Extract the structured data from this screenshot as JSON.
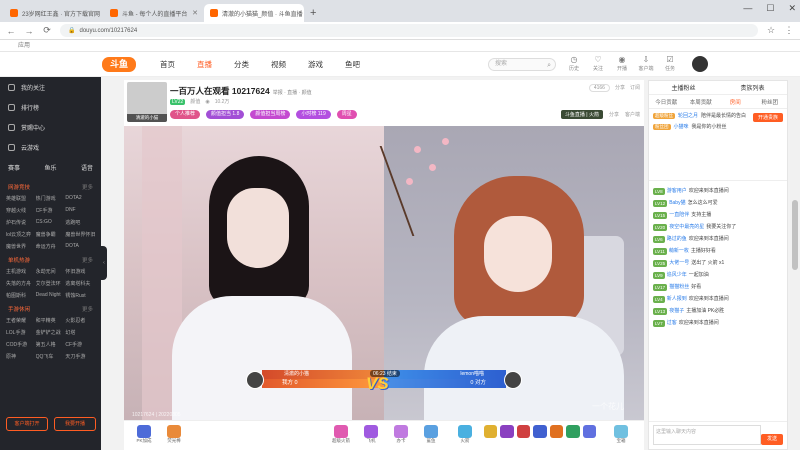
{
  "browser": {
    "tabs": [
      {
        "label": "23岁网红王鑫 · 官方下载官网"
      },
      {
        "label": "斗鱼 - 每个人的直播平台"
      },
      {
        "label": "清澈的小猫猫_颜值 · 斗鱼直播"
      }
    ],
    "url": "douyu.com/10217624",
    "bookmarks": "应用"
  },
  "site": {
    "logo": "斗鱼",
    "nav": [
      "首页",
      "直播",
      "分类",
      "视频",
      "游戏",
      "鱼吧"
    ],
    "search_placeholder": "搜索",
    "header_icons": [
      "历史",
      "关注",
      "开播",
      "客户端",
      "任务"
    ]
  },
  "sidebar": {
    "items": [
      "我的关注",
      "排行榜",
      "赏赐中心",
      "云游戏"
    ],
    "row_items": [
      "赛事",
      "鱼乐",
      "语音"
    ],
    "sections": [
      {
        "title": "网游竞技",
        "more": "更多",
        "games": [
          "英雄联盟",
          "热门游戏",
          "DOTA2",
          "穿越火线",
          "CF手游",
          "DNF",
          "炉石传说",
          "CS:GO",
          "逃跑吧",
          "lol云顶之弈",
          "魔兽争霸",
          "魔兽世界怀旧服",
          "魔兽世界",
          "命运方舟",
          "DOTA",
          "魔兽世界",
          "天涯明月刀",
          "APEX英雄"
        ]
      },
      {
        "title": "单机热游",
        "more": "更多",
        "games": [
          "主机游戏",
          "永劫无间",
          "怀旧游戏",
          "失落的方舟",
          "艾尔登法环",
          "逃离塔科夫",
          "帕图斯科",
          "Dead Night",
          "锈蚀Rust"
        ]
      },
      {
        "title": "手游休闲",
        "more": "更多",
        "games": [
          "王者荣耀",
          "和平精英",
          "火影忍者",
          "LOL手游",
          "金铲铲之战",
          "幻塔",
          "COD手游",
          "第五人格",
          "CF手游",
          "原神",
          "QQ飞车",
          "天刀手游"
        ]
      }
    ],
    "btn_client": "客户端打开",
    "btn_live": "我要开播"
  },
  "room": {
    "host_name": "清澈的小猫",
    "title": "一百万人在观看 10217624",
    "title_extra": "举报 · 直播 · 颜值",
    "level": "LV22",
    "category": "颜值",
    "viewers": "10.2万",
    "tags": [
      {
        "label": "个人推荐",
        "color": "#e0558a"
      },
      {
        "label": "颜值担当 1.8",
        "color": "#a24fd6"
      },
      {
        "label": "颜值担当周榜",
        "color": "#c44ad0"
      },
      {
        "label": "小时榜 119",
        "color": "#b34fe0"
      },
      {
        "label": "周星",
        "color": "#e04fb0"
      }
    ],
    "right_pills": [
      "4166",
      "分享",
      "订阅"
    ],
    "banner": "斗鱼直播 | 火箭",
    "actions": [
      "分享",
      "客户端"
    ]
  },
  "player": {
    "room_number": "10217624 | 20220305",
    "watermark": "一个花儿",
    "pk": {
      "left_name": "清澈的小猫",
      "right_name": "lemon喵喵",
      "left_score": "我方 0",
      "right_score": "0 对方",
      "timer": "06:23 结束"
    }
  },
  "gifts": [
    "PK加成",
    "荧光棒",
    "超级火箭",
    "飞机",
    "办卡",
    "鲨鱼",
    "火箭",
    "宝箱",
    "守护"
  ],
  "rpanel": {
    "tabs1": [
      "主播粉丝",
      "贵族列表"
    ],
    "tabs2": [
      "今日贡献",
      "本周贡献",
      "房间",
      "粉丝团"
    ],
    "open_btn": "开通贵族",
    "rank": [
      {
        "user": "轮回之月",
        "badge": "超级粉丝",
        "text": "陪伴是最长情的告白"
      },
      {
        "user": "小猫咪",
        "badge": "粉丝团",
        "text": "我是你的小粉丝"
      }
    ],
    "chat": [
      {
        "lv": "LV8",
        "user": "游客用户",
        "text": "欢迎来到本直播间"
      },
      {
        "lv": "LV12",
        "user": "Baby猫",
        "text": "怎么这么可爱"
      },
      {
        "lv": "LV15",
        "user": "一直陪伴",
        "text": "支持主播"
      },
      {
        "lv": "LV20",
        "user": "夜空中最亮的星",
        "text": "我要关注你了"
      },
      {
        "lv": "LV6",
        "user": "路过的鱼",
        "text": "欢迎来到本直播间"
      },
      {
        "lv": "LV11",
        "user": "萌新一枚",
        "text": "主播好好看"
      },
      {
        "lv": "LV25",
        "user": "大佬一号",
        "text": "送出了 火箭 x1"
      },
      {
        "lv": "LV9",
        "user": "追风少年",
        "text": "一起加油"
      },
      {
        "lv": "LV17",
        "user": "猫猫粉丝",
        "text": "好看"
      },
      {
        "lv": "LV4",
        "user": "新人报到",
        "text": "欢迎来到本直播间"
      },
      {
        "lv": "LV13",
        "user": "夜猫子",
        "text": "主播加油 PK必胜"
      },
      {
        "lv": "LV7",
        "user": "过客",
        "text": "欢迎来到本直播间"
      }
    ],
    "input_placeholder": "这里输入聊天内容",
    "send": "发送"
  },
  "colors": {
    "accent": "#ff5d23",
    "sidebar_bg": "#23252b"
  }
}
